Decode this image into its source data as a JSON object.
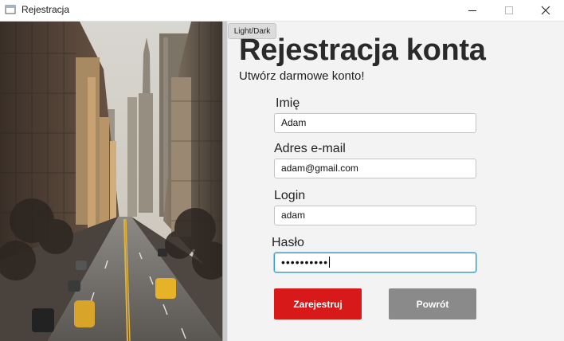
{
  "window": {
    "title": "Rejestracja",
    "icon": "app-window-icon"
  },
  "theme_toggle": {
    "label": "Light/Dark"
  },
  "form": {
    "heading": "Rejestracja konta",
    "subheading": "Utwórz darmowe konto!",
    "fields": {
      "name": {
        "label": "Imię",
        "value": "Adam"
      },
      "email": {
        "label": "Adres e-mail",
        "value": "adam@gmail.com"
      },
      "login": {
        "label": "Login",
        "value": "adam"
      },
      "password": {
        "label": "Hasło",
        "value": "••••••••••"
      }
    },
    "register_button": "Zarejestruj",
    "back_button": "Powrót"
  },
  "colors": {
    "register": "#d71919",
    "back": "#8a8a8a",
    "focus": "#2a9fd6"
  }
}
